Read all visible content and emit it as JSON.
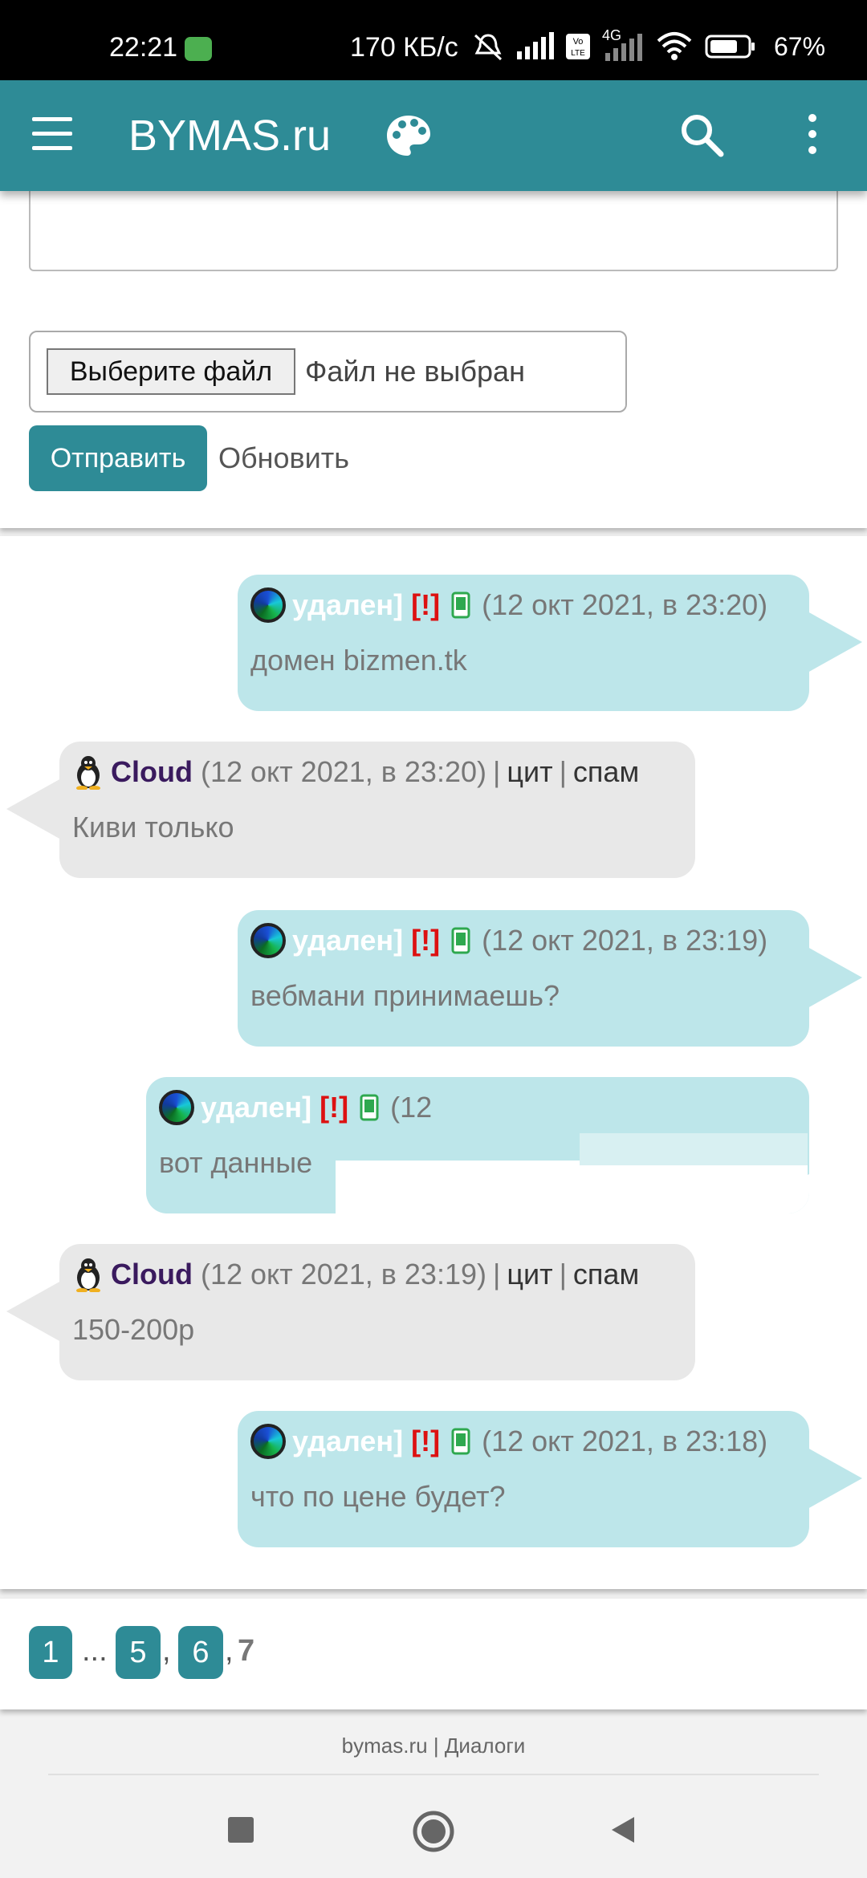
{
  "status_bar": {
    "time": "22:21",
    "speed": "170 КБ/с",
    "network_label": "4G",
    "battery": "67%"
  },
  "app_bar": {
    "title": "BYMAS.ru"
  },
  "form": {
    "choose_file_label": "Выберите файл",
    "file_status": "Файл не выбран",
    "send_label": "Отправить",
    "refresh_label": "Обновить"
  },
  "messages": [
    {
      "side": "mine",
      "author": "удален]",
      "flag": "[!]",
      "date": "(12 окт 2021, в 23:20)",
      "text": "домен bizmen.tk"
    },
    {
      "side": "theirs",
      "author": "Cloud",
      "date": "(12 окт 2021, в 23:20)",
      "sep": "|",
      "quote": "цит",
      "spam": "спам",
      "text": "Киви только"
    },
    {
      "side": "mine",
      "author": "удален]",
      "flag": "[!]",
      "date": "(12 окт 2021, в 23:19)",
      "text": "вебмани принимаешь?"
    },
    {
      "side": "mine",
      "author": "удален]",
      "flag": "[!]",
      "date": "(12",
      "text": "вот данные"
    },
    {
      "side": "theirs",
      "author": "Cloud",
      "date": "(12 окт 2021, в 23:19)",
      "sep": "|",
      "quote": "цит",
      "spam": "спам",
      "text": "150-200р"
    },
    {
      "side": "mine",
      "author": "удален]",
      "flag": "[!]",
      "date": "(12 окт 2021, в 23:18)",
      "text": "что по цене будет?"
    }
  ],
  "pagination": {
    "first": "1",
    "ellipsis": "...",
    "p5": "5",
    "comma": ",",
    "p6": "6",
    "current": "7"
  },
  "footer": {
    "site": "bymas.ru",
    "sep": "|",
    "section": "Диалоги"
  },
  "colors": {
    "accent": "#2e8b96",
    "bubble_mine": "#bde6ea",
    "bubble_theirs": "#e8e8e8",
    "flag_red": "#d11111"
  }
}
